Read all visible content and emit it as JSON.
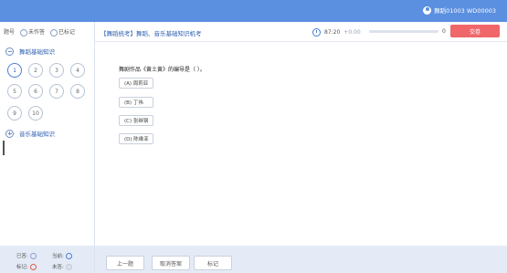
{
  "header": {
    "user_text": "舞蹈01003 WD00003"
  },
  "sidebar": {
    "filters": {
      "label": "题号",
      "unanswered": "未作答",
      "marked": "已标记"
    },
    "sections": [
      {
        "title": "舞蹈基础知识",
        "expanded": true
      },
      {
        "title": "音乐基础知识",
        "expanded": false
      }
    ],
    "questions": [
      "1",
      "2",
      "3",
      "4",
      "5",
      "6",
      "7",
      "8",
      "9",
      "10"
    ],
    "current_question": "1",
    "legend": {
      "answered": "已答:",
      "current": "当前:",
      "flagged": "标记:",
      "unanswered": "未答:"
    }
  },
  "exam": {
    "title": "【舞蹈统考】舞蹈、音乐基础知识机考",
    "time": "87:20",
    "time_delta": "+0.00",
    "progress_count": "0",
    "progress_fraction": 0,
    "submit_label": "交卷"
  },
  "question": {
    "text": "舞剧作品《黄土黄》的编导是（ ）。",
    "options": [
      "(A) 周莉亚",
      "(B) 丁伟",
      "(C) 张继钢",
      "(D) 陈维亚"
    ]
  },
  "footer": {
    "prev": "上一题",
    "cancel": "取消答案",
    "mark": "标记"
  },
  "colors": {
    "accent": "#5b8fe0",
    "submit": "#f0676a"
  }
}
